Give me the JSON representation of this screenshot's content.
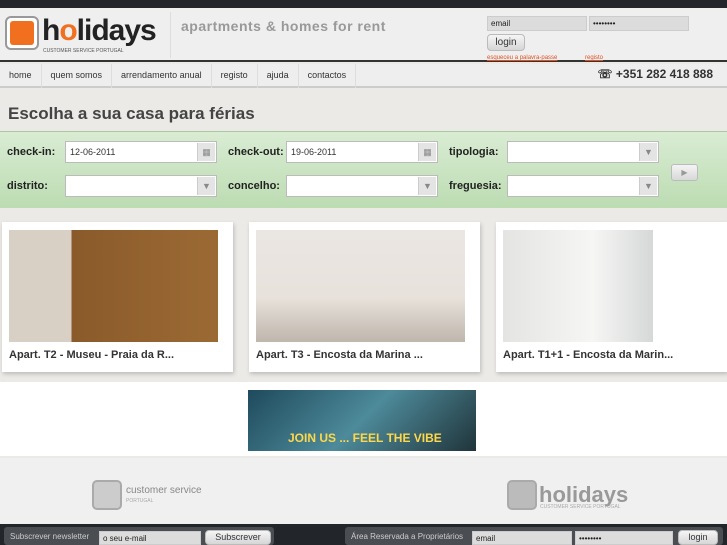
{
  "header": {
    "logo_text": "holidays",
    "logo_sub": "CUSTOMER SERVICE PORTUGAL",
    "tagline": "apartments & homes for rent",
    "email_value": "email",
    "password_value": "••••••••",
    "login_label": "login",
    "forgot_link": "esqueceu a palavra-passe",
    "register_link": "registo"
  },
  "nav": {
    "items": [
      "home",
      "quem somos",
      "arrendamento anual",
      "registo",
      "ajuda",
      "contactos"
    ],
    "phone": "+351 282 418 888"
  },
  "page_title": "Escolha a sua casa para férias",
  "search": {
    "checkin_label": "check-in:",
    "checkin_value": "12-06-2011",
    "checkout_label": "check-out:",
    "checkout_value": "19-06-2011",
    "tipologia_label": "tipologia:",
    "distrito_label": "distrito:",
    "concelho_label": "concelho:",
    "freguesia_label": "freguesia:",
    "submit": "▶"
  },
  "listings": [
    {
      "title": "Apart. T2 - Museu - Praia da R..."
    },
    {
      "title": "Apart. T3 - Encosta da Marina ..."
    },
    {
      "title": "Apart. T1+1 - Encosta da Marin..."
    }
  ],
  "banner": {
    "text": "JOIN US ... FEEL THE VIBE"
  },
  "footer": {
    "cs_logo": "customer service",
    "cs_sub": "PORTUGAL",
    "holidays_logo": "holidays",
    "holidays_sub": "CUSTOMER SERVICE PORTUGAL"
  },
  "bottom": {
    "newsletter_label": "Subscrever newsletter",
    "newsletter_placeholder": "o seu e-mail",
    "subscribe": "Subscrever",
    "owners_label": "Área Reservada a Proprietários",
    "email_value": "email",
    "password_value": "••••••••",
    "login": "login"
  },
  "colors": {
    "accent": "#f07020",
    "search_bg": "#c8e2bf",
    "dark": "#23262b"
  }
}
